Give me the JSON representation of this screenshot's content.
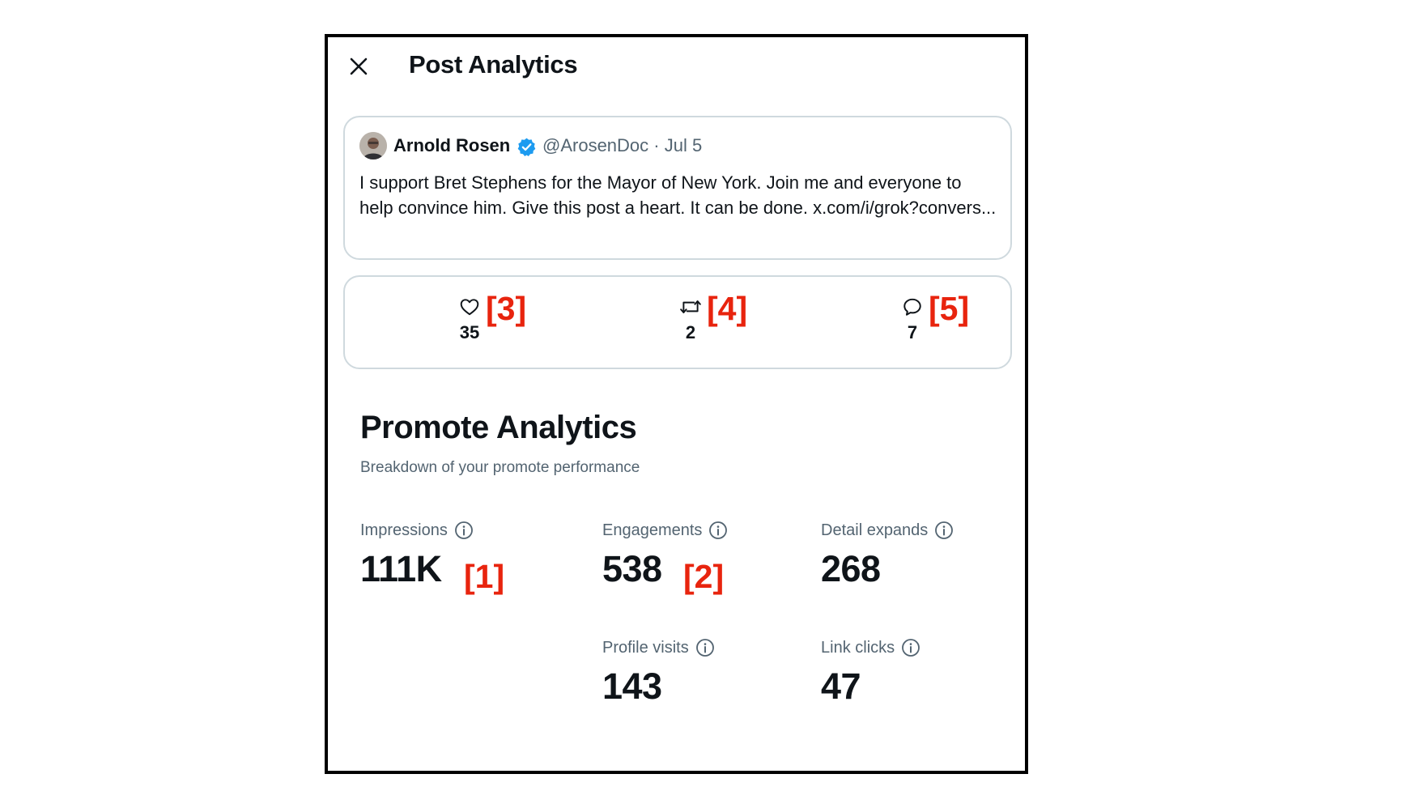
{
  "header": {
    "title": "Post Analytics",
    "close_icon": "close-icon"
  },
  "post": {
    "author_name": "Arnold Rosen",
    "verified_icon": "verified-badge-icon",
    "handle_date": "@ArosenDoc · Jul 5",
    "text": "I support Bret Stephens for the Mayor of New York. Join me and everyone to help convince him. Give this post a heart. It can be done. x.com/i/grok?convers..."
  },
  "stats": {
    "likes": {
      "icon": "heart-icon",
      "count": "35",
      "marker": "[3]"
    },
    "reposts": {
      "icon": "repost-icon",
      "count": "2",
      "marker": "[4]"
    },
    "replies": {
      "icon": "reply-icon",
      "count": "7",
      "marker": "[5]"
    }
  },
  "promote": {
    "title": "Promote Analytics",
    "subtitle": "Breakdown of your promote performance",
    "metrics": {
      "impressions": {
        "label": "Impressions",
        "value": "111K",
        "marker": "[1]"
      },
      "engagements": {
        "label": "Engagements",
        "value": "538",
        "marker": "[2]"
      },
      "detail_expands": {
        "label": "Detail expands",
        "value": "268"
      },
      "profile_visits": {
        "label": "Profile visits",
        "value": "143"
      },
      "link_clicks": {
        "label": "Link clicks",
        "value": "47"
      }
    }
  },
  "colors": {
    "text": "#0f1419",
    "secondary": "#536471",
    "border": "#cfd9de",
    "verified": "#1d9bf0",
    "marker": "#e8240e"
  }
}
